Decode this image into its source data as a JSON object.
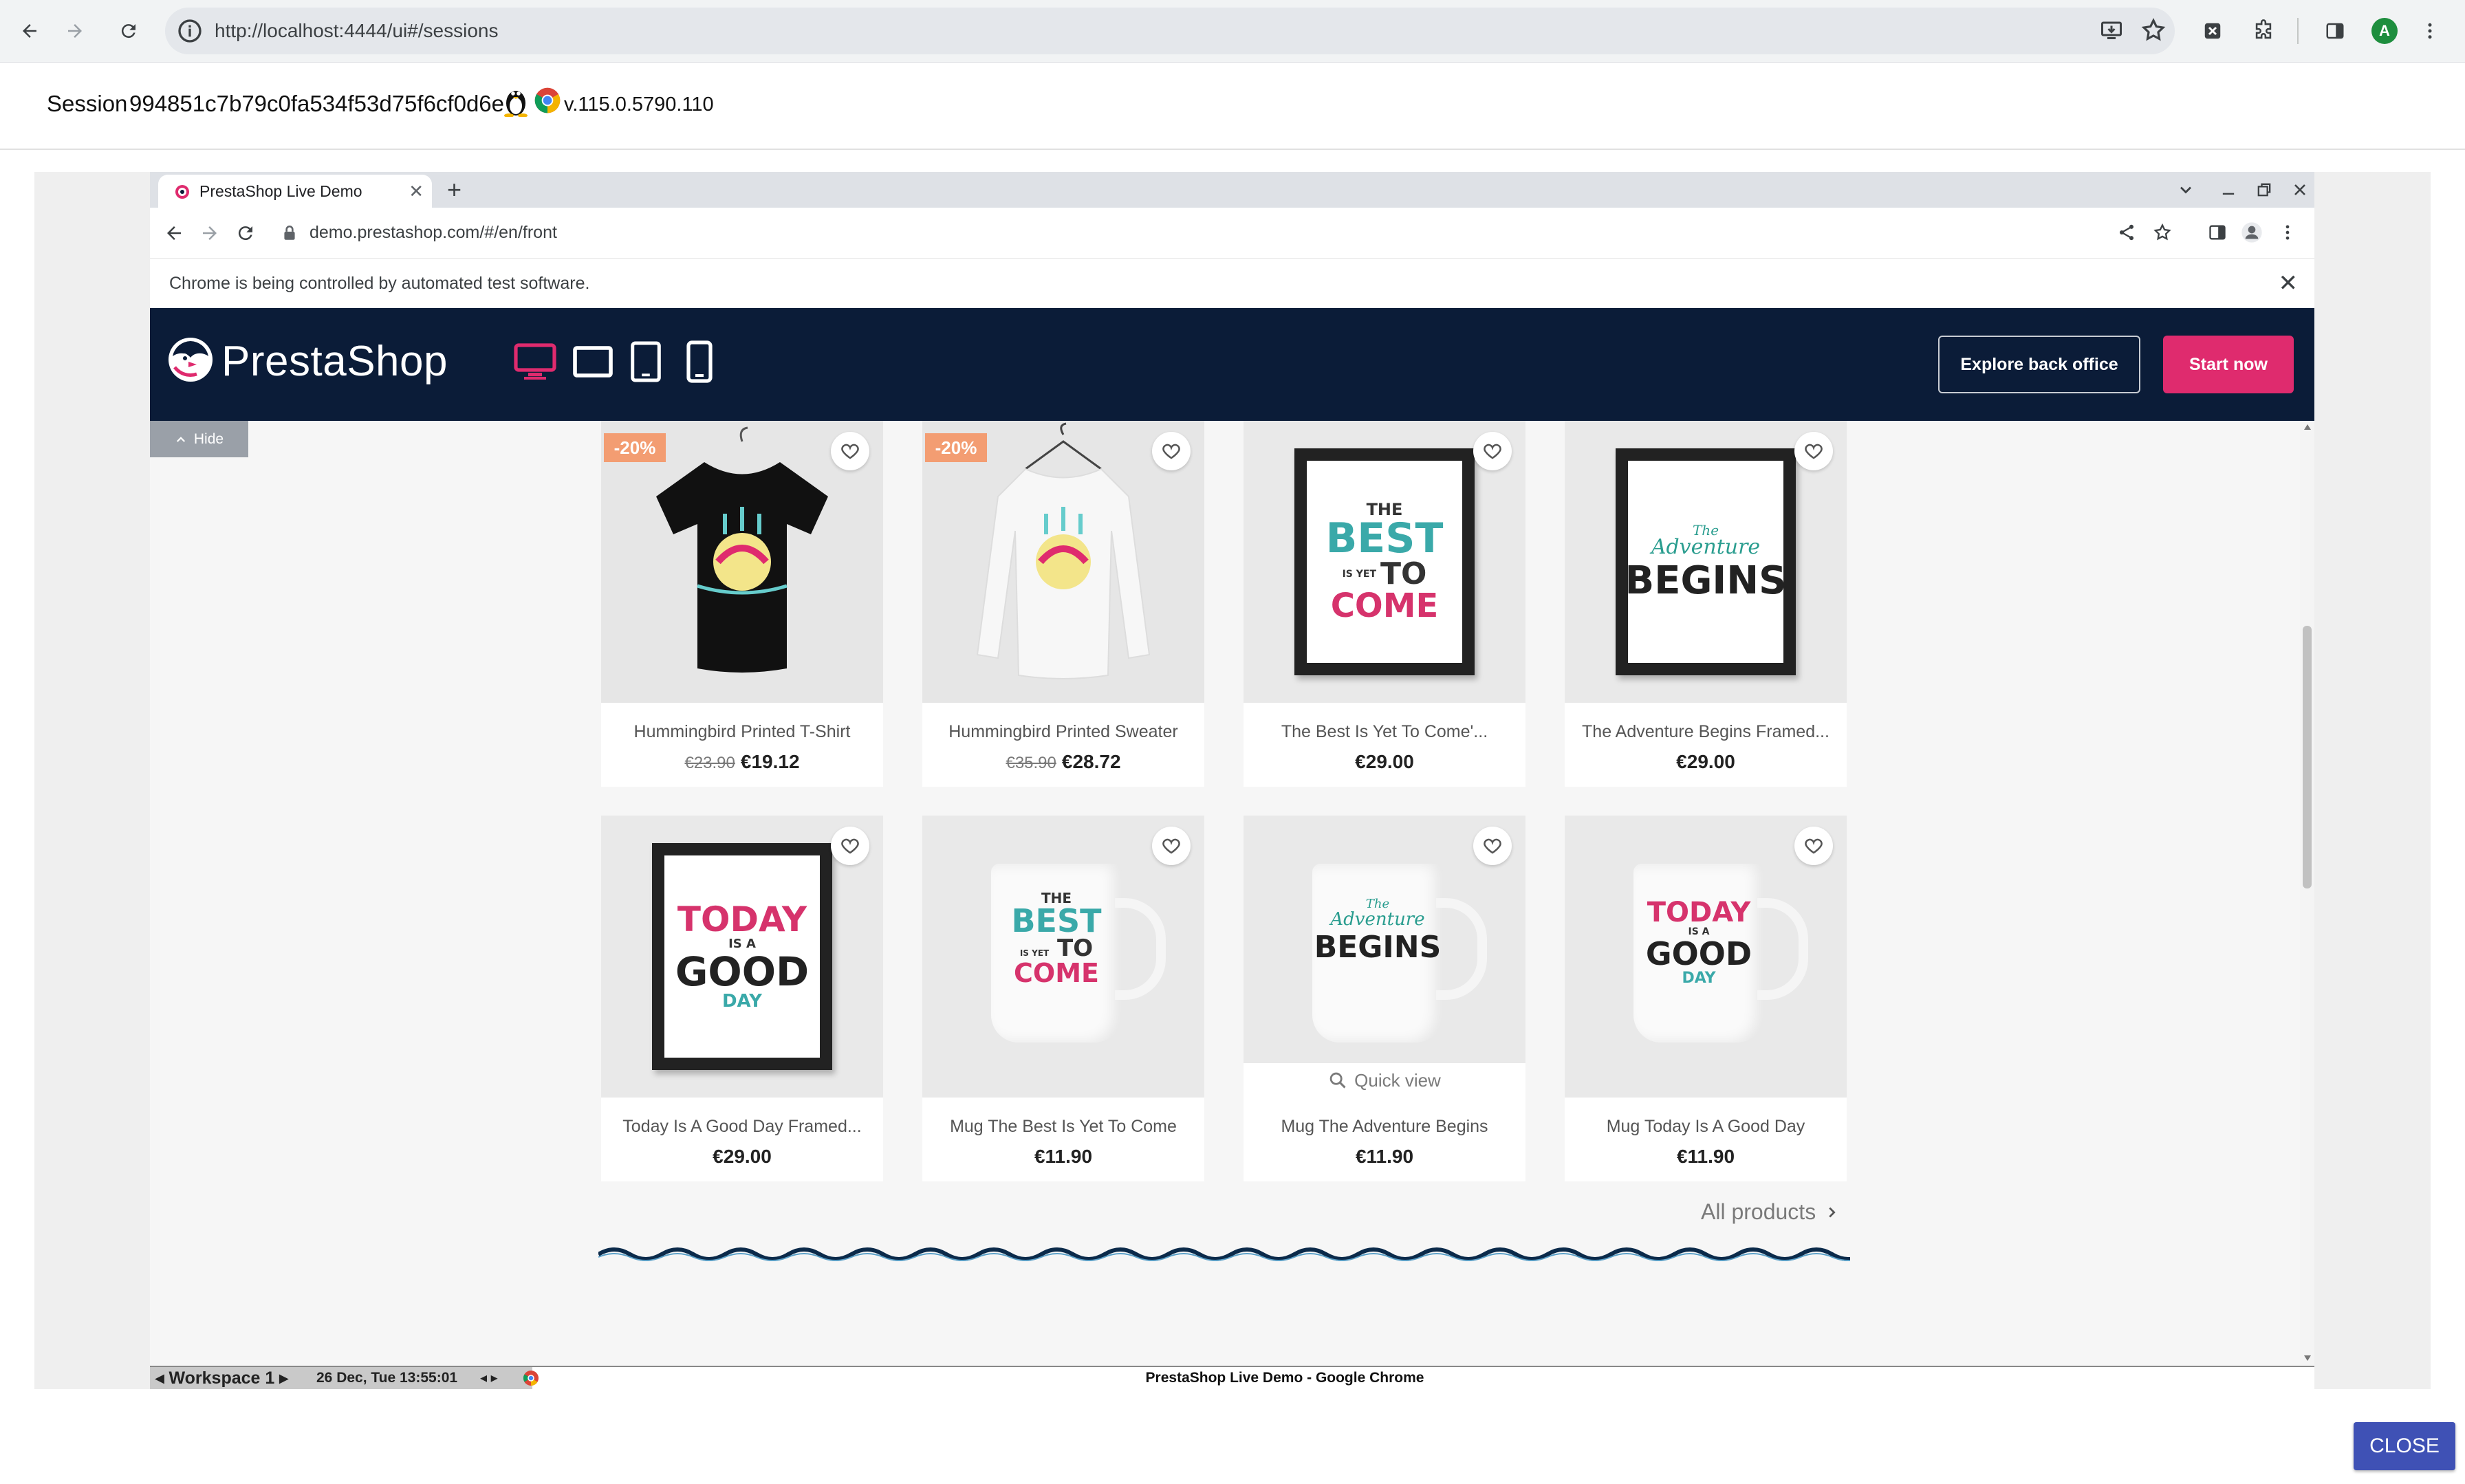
{
  "browser": {
    "url": "http://localhost:4444/ui#/sessions",
    "profile_initial": "A"
  },
  "session": {
    "label": "Session",
    "id": "994851c7b79c0fa534f53d75f6cf0d6e",
    "version": "v.115.0.5790.110"
  },
  "remote_browser": {
    "tab_title": "PrestaShop Live Demo",
    "url": "demo.prestashop.com/#/en/front",
    "infobar_text": "Chrome is being controlled by automated test software."
  },
  "prestashop": {
    "logo_text": "PrestaShop",
    "explore_label": "Explore back office",
    "start_label": "Start now",
    "hide_label": "Hide",
    "quick_view_label": "Quick view",
    "all_products_label": "All products",
    "accent_color": "#df2b6e",
    "header_bg": "#0b1c38"
  },
  "products": [
    {
      "name": "Hummingbird Printed T-Shirt",
      "old_price": "€23.90",
      "price": "€19.12",
      "badge": "-20%",
      "image": "tshirt-black"
    },
    {
      "name": "Hummingbird Printed Sweater",
      "old_price": "€35.90",
      "price": "€28.72",
      "badge": "-20%",
      "image": "sweater-white"
    },
    {
      "name": "The Best Is Yet To Come'...",
      "price": "€29.00",
      "image": "frame-best"
    },
    {
      "name": "The Adventure Begins Framed...",
      "price": "€29.00",
      "image": "frame-adventure"
    },
    {
      "name": "Today Is A Good Day Framed...",
      "price": "€29.00",
      "image": "frame-today"
    },
    {
      "name": "Mug The Best Is Yet To Come",
      "price": "€11.90",
      "image": "mug-best"
    },
    {
      "name": "Mug The Adventure Begins",
      "price": "€11.90",
      "image": "mug-adventure"
    },
    {
      "name": "Mug Today Is A Good Day",
      "price": "€11.90",
      "image": "mug-today"
    }
  ],
  "poster_text": {
    "best": [
      "THE",
      "BEST",
      "IS YET",
      "TO",
      "COME"
    ],
    "adventure": [
      "The",
      "Adventure",
      "BEGINS"
    ],
    "today": [
      "TODAY",
      "IS A",
      "GOOD",
      "DAY"
    ]
  },
  "taskbar": {
    "workspace": "Workspace 1",
    "datetime": "26 Dec, Tue 13:55:01",
    "window_title": "PrestaShop Live Demo - Google Chrome"
  },
  "footer": {
    "close_label": "CLOSE"
  }
}
